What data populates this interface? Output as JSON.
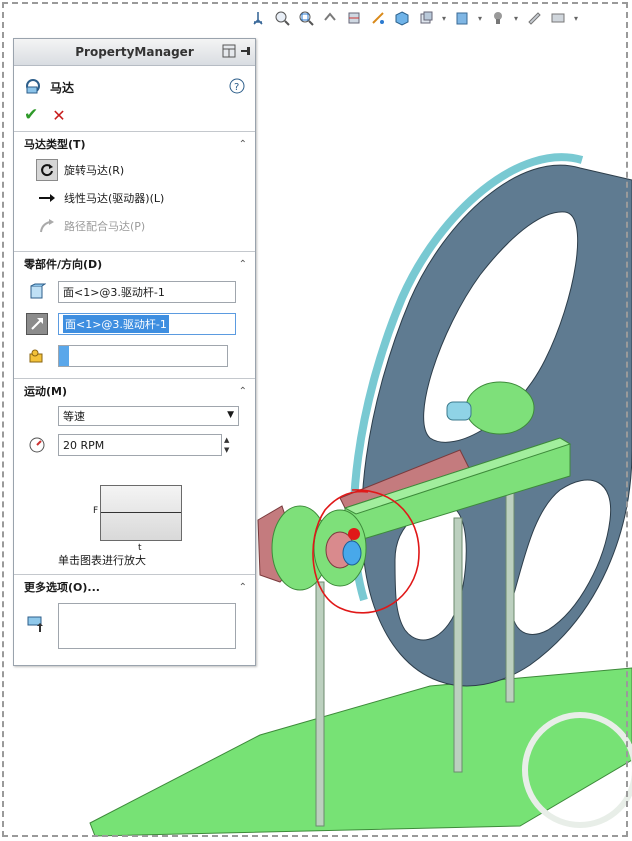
{
  "toolbar": {
    "icons": [
      "view-orientation-icon",
      "zoom-to-fit-icon",
      "zoom-area-icon",
      "previous-view-icon",
      "section-view-icon",
      "dynamic-annotation-icon",
      "display-style-icon",
      "hide-show-items-icon",
      "edit-appearance-icon",
      "apply-scene-icon",
      "view-settings-icon"
    ]
  },
  "panel": {
    "header_title": "PropertyManager",
    "feature_title": "马达",
    "help_icon": "help-icon",
    "ok_icon": "check-icon",
    "cancel_icon": "x-icon"
  },
  "motor_type": {
    "heading": "马达类型(T)",
    "options": [
      {
        "label": "旋转马达(R)",
        "icon": "rotary-motor-icon",
        "selected": true,
        "enabled": true
      },
      {
        "label": "线性马达(驱动器)(L)",
        "icon": "linear-motor-icon",
        "selected": false,
        "enabled": true
      },
      {
        "label": "路径配合马达(P)",
        "icon": "path-mate-motor-icon",
        "selected": false,
        "enabled": false
      }
    ]
  },
  "component_direction": {
    "heading": "零部件/方向(D)",
    "direction_face": "面<1>@3.驱动杆-1",
    "component_face": "面<1>@3.驱动杆-1",
    "relative_component": ""
  },
  "motion": {
    "heading": "运动(M)",
    "type": "等速",
    "speed": "20 RPM",
    "graph_y": "F",
    "graph_x": "t",
    "graph_hint": "单击图表进行放大"
  },
  "more_options": {
    "heading": "更多选项(O)...",
    "load_bearing_faces": ""
  },
  "colors": {
    "wheel": "#5f7b91",
    "wheel_rim": "#79c9d2",
    "green_part": "#7ee07a",
    "rod": "#bcd0bf",
    "red_link": "#c47b7e",
    "selection_circle": "#e01818",
    "highlight_blue": "#3e8ee0"
  }
}
